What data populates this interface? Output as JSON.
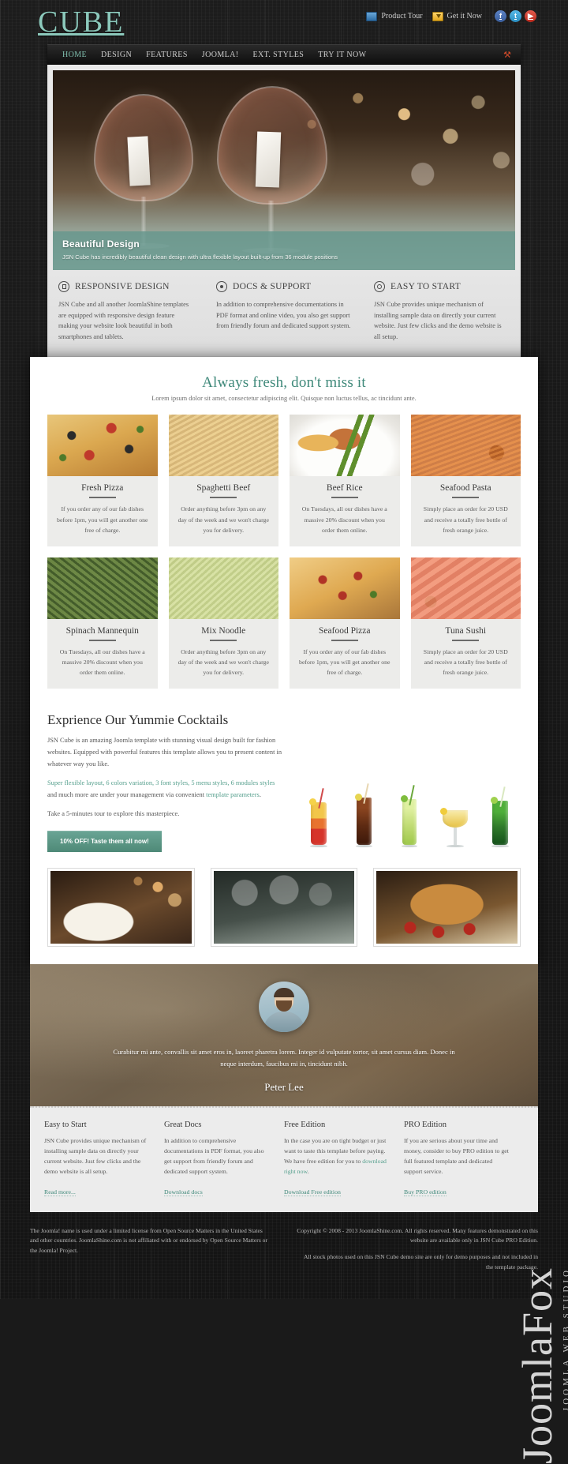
{
  "site": {
    "logo": "CUBE"
  },
  "topnav": {
    "product_tour": "Product Tour",
    "get_it_now": "Get it Now",
    "social": [
      {
        "name": "facebook",
        "glyph": "f"
      },
      {
        "name": "twitter",
        "glyph": "t"
      },
      {
        "name": "youtube",
        "glyph": "▶"
      }
    ]
  },
  "menu": {
    "items": [
      {
        "label": "HOME",
        "active": true
      },
      {
        "label": "DESIGN",
        "active": false
      },
      {
        "label": "FEATURES",
        "active": false
      },
      {
        "label": "JOOMLA!",
        "active": false
      },
      {
        "label": "EXT. STYLES",
        "active": false
      },
      {
        "label": "TRY IT NOW",
        "active": false
      }
    ],
    "tools_icon": "⚒"
  },
  "hero": {
    "title": "Beautiful Design",
    "subtitle": "JSN Cube has incredibly beautiful clean design with ultra flexible layout built-up from 36 module positions"
  },
  "features": [
    {
      "icon": "square-in-circle-icon",
      "title": "RESPONSIVE DESIGN",
      "text": "JSN Cube and all another JoomlaShine templates are equipped with responsive design feature making your website look beautiful in both smartphones and tablets."
    },
    {
      "icon": "dot-in-circle-icon",
      "title": "DOCS & SUPPORT",
      "text": "In addition to comprehensive documentations in PDF format and online video, you also get support from friendly forum and dedicated support system."
    },
    {
      "icon": "ring-in-circle-icon",
      "title": "EASY TO START",
      "text": "JSN Cube provides unique mechanism of installing sample data on directly your current website. Just few clicks and the demo website is all setup."
    }
  ],
  "fresh": {
    "heading": "Always fresh, don't miss it",
    "subheading": "Lorem ipsum dolor sit amet, consectetur adipiscing elit. Quisque non luctus tellus, ac tincidunt ante.",
    "cards": [
      {
        "title": "Fresh Pizza",
        "text": "If you order any of our fab dishes before 1pm, you will get another one free of charge.",
        "art": "ph-pizza"
      },
      {
        "title": "Spaghetti Beef",
        "text": "Order anything before 3pm on any day of the week and we won't charge you for delivery.",
        "art": "ph-spag"
      },
      {
        "title": "Beef Rice",
        "text": "On Tuesdays, all our dishes have a massive 20% discount when you order them online.",
        "art": "ph-beefrice"
      },
      {
        "title": "Seafood Pasta",
        "text": "Simply place an order for 20 USD and receive a totally free bottle of fresh orange juice.",
        "art": "ph-seapasta"
      },
      {
        "title": "Spinach Mannequin",
        "text": "On Tuesdays, all our dishes have a massive 20% discount when you order them online.",
        "art": "ph-spinach"
      },
      {
        "title": "Mix Noodle",
        "text": "Order anything before 3pm on any day of the week and we won't charge you for delivery.",
        "art": "ph-mixnoodle"
      },
      {
        "title": "Seafood Pizza",
        "text": "If you order any of our fab dishes before 1pm, you will get another one free of charge.",
        "art": "ph-seapizza"
      },
      {
        "title": "Tuna Sushi",
        "text": "Simply place an order for 20 USD and receive a totally free bottle of fresh orange juice.",
        "art": "ph-tuna"
      }
    ]
  },
  "cocktails": {
    "heading": "Exprience Our Yummie Cocktails",
    "p1": "JSN Cube is an amazing Joomla template with stunning visual design built for fashion websites. Equipped with powerful features this template allows you to present content in whatever way you like.",
    "p2_link": "Super flexible layout, 6 colors variation, 3 font styles, 5 menu styles, 6 modules styles",
    "p2_rest": " and much more are under your management via convenient ",
    "p2_link2": "template parameters",
    "p2_end": ".",
    "p3": "Take a 5-minutes tour to explore this masterpiece.",
    "button": "10% OFF! Taste them all now!",
    "drinks": [
      {
        "name": "sunrise-cocktail",
        "top": "#f2c64a",
        "bottom": "#d6342a"
      },
      {
        "name": "cola-cocktail",
        "top": "#7a3a1c",
        "bottom": "#4a1e0c"
      },
      {
        "name": "mojito-cocktail",
        "top": "#c8e07a",
        "bottom": "#9ec84a"
      },
      {
        "name": "margarita-cocktail",
        "top": "#f6e08a",
        "bottom": "#e6c243"
      },
      {
        "name": "green-cocktail",
        "top": "#2f7a2a",
        "bottom": "#15541a"
      }
    ]
  },
  "strip": [
    {
      "name": "salad-photo",
      "art": "sp-salad"
    },
    {
      "name": "table-setting-photo",
      "art": "sp-table"
    },
    {
      "name": "roast-turkey-photo",
      "art": "sp-turkey"
    }
  ],
  "testimonial": {
    "quote": "Curabitur mi ante, convallis sit amet eros in, laoreet pharetra lorem. Integer id vulputate tortor, sit amet cursus diam. Donec in neque interdum, faucibus mi in, tincidunt nibh.",
    "author": "Peter Lee"
  },
  "footer": {
    "columns": [
      {
        "title": "Easy to Start",
        "text": "JSN Cube provides unique mechanism of installing sample data on directly your current website. Just few clicks and the demo website is all setup.",
        "link": "Read more..."
      },
      {
        "title": "Great Docs",
        "text": "In addition to comprehensive documentations in PDF format, you also get support from friendly forum and dedicated support system.",
        "link": "Download docs"
      },
      {
        "title": "Free Edition",
        "text_a": "In the case you are on tight budget or just want to taste this template before paying. We have free edition for you to ",
        "text_link": "download right now",
        "text_b": ".",
        "link": "Download Free edition"
      },
      {
        "title": "PRO Edition",
        "text": "If you are serious about your time and money, consider to buy PRO edition to get full featured template and dedicated support service.",
        "link": "Buy PRO edition"
      }
    ]
  },
  "copyright": {
    "left": "The Joomla! name is used under a limited license from Open Source Matters in the United States and other countries. JoomlaShine.com is not affiliated with or endorsed by Open Source Matters or the Joomla! Project.",
    "right_1": "Copyright © 2008 - 2013 JoomlaShine.com. All rights reserved. Many features demonstrated on this website are available only in JSN Cube PRO Edition.",
    "right_2": "All stock photos used on this JSN Cube demo site are only for demo purposes and not included in the template package."
  },
  "watermark": {
    "main": "JoomlaFox",
    "sub": "JOOMLA WEB STUDIO"
  },
  "colors": {
    "teal": "#3f897a",
    "teal_light": "#8cc9bc",
    "dark": "#191919"
  }
}
